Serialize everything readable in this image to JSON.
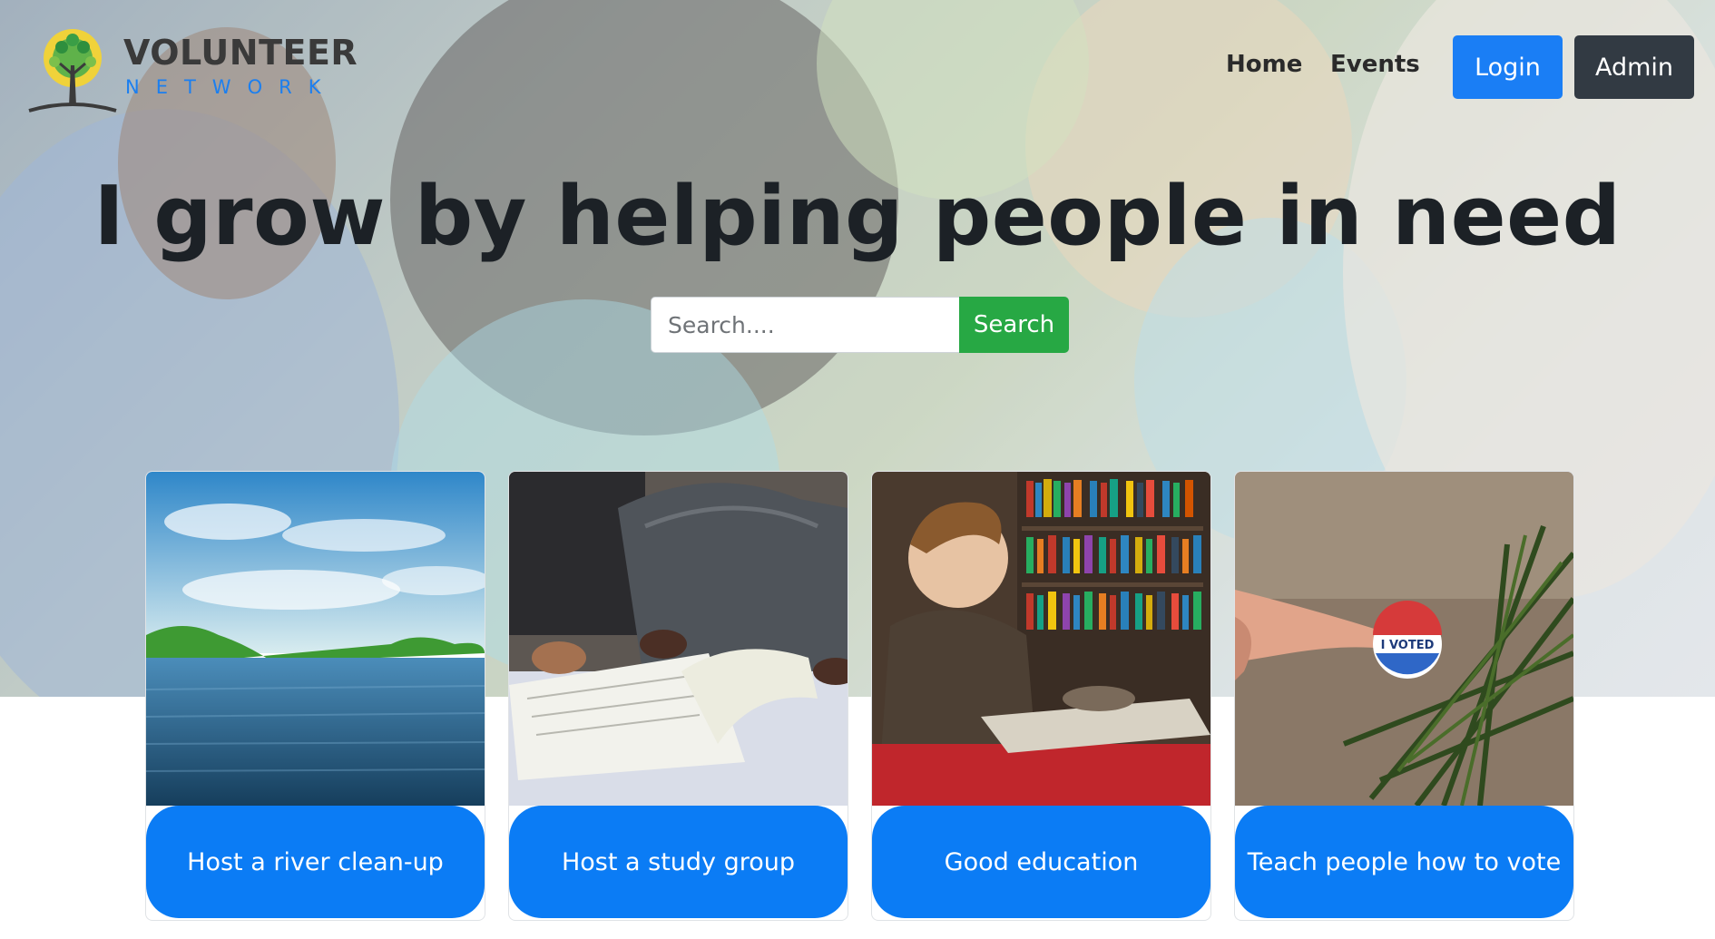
{
  "brand": {
    "name": "VOLUNTEER",
    "tagline": "NETWORK"
  },
  "nav": {
    "home": "Home",
    "events": "Events",
    "login": "Login",
    "admin": "Admin"
  },
  "hero": {
    "headline": "I grow by helping people in need"
  },
  "search": {
    "placeholder": "Search....",
    "button": "Search"
  },
  "cards": [
    {
      "label": "Host a river clean-up",
      "image": "river-landscape"
    },
    {
      "label": "Host a study group",
      "image": "person-reading-notebook"
    },
    {
      "label": "Good education",
      "image": "boy-reading-in-library"
    },
    {
      "label": "Teach people how to vote",
      "image": "i-voted-sticker",
      "sticker_text": "I VOTED"
    }
  ],
  "colors": {
    "primary": "#0b7cf5",
    "login": "#1a7ef5",
    "admin": "#323a43",
    "search": "#27a844",
    "headline": "#1c2126",
    "brand_blue": "#1b7ff0"
  }
}
